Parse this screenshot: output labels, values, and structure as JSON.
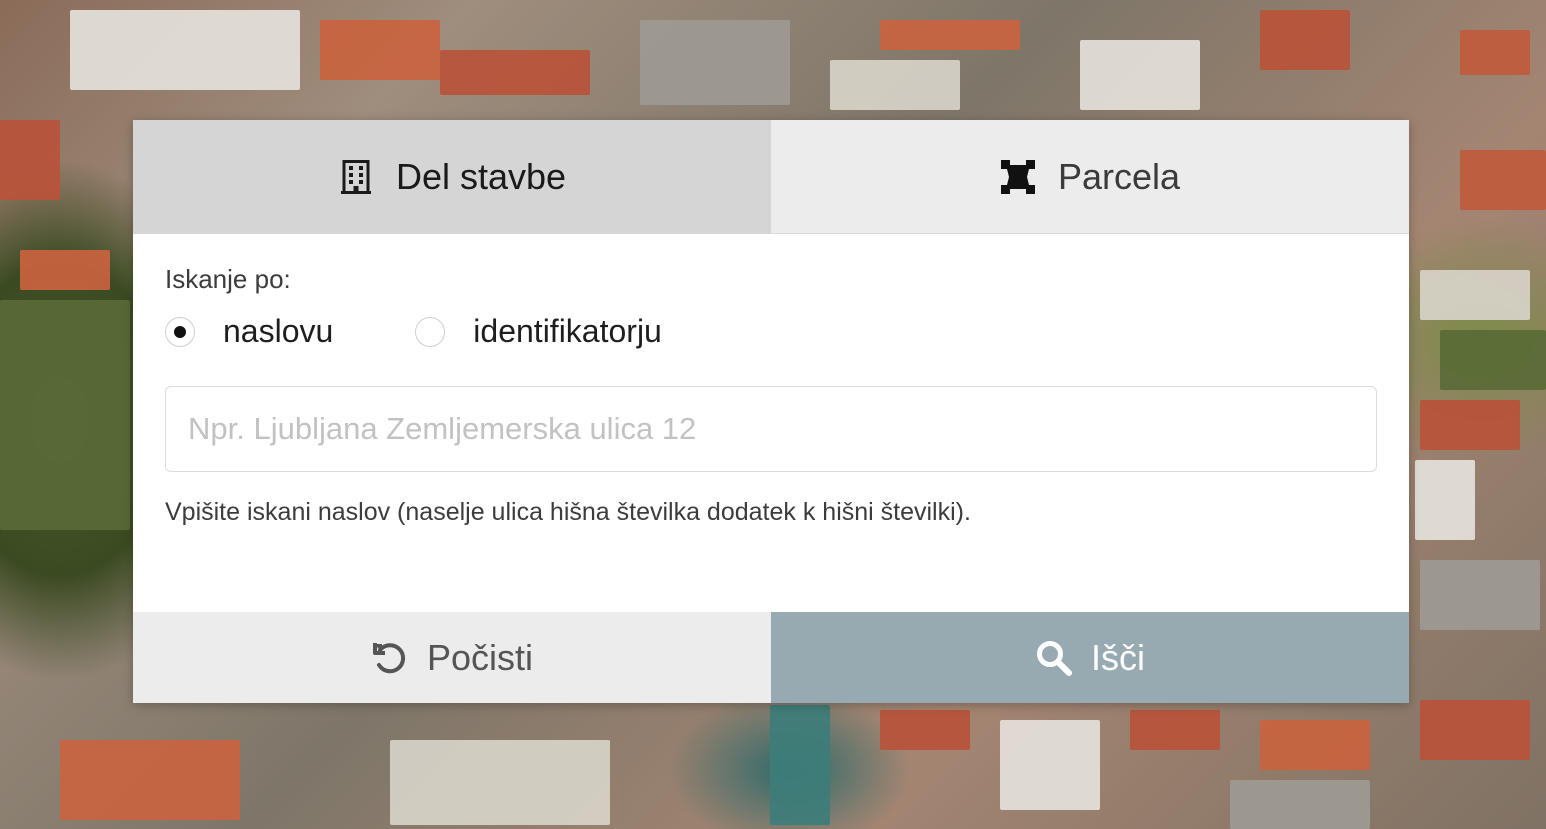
{
  "tabs": [
    {
      "label": "Del stavbe",
      "icon": "building-icon",
      "active": true
    },
    {
      "label": "Parcela",
      "icon": "parcel-polygon-icon",
      "active": false
    }
  ],
  "form": {
    "search_by_label": "Iskanje po:",
    "radio_options": [
      {
        "label": "naslovu",
        "checked": true
      },
      {
        "label": "identifikatorju",
        "checked": false
      }
    ],
    "input_value": "",
    "input_placeholder": "Npr. Ljubljana Zemljemerska ulica 12",
    "hint": "Vpišite iskani naslov (naselje ulica hišna številka dodatek k hišni številki)."
  },
  "buttons": {
    "clear_label": "Počisti",
    "clear_icon": "undo-icon",
    "search_label": "Išči",
    "search_icon": "search-icon"
  },
  "colors": {
    "active_tab": "#d5d5d5",
    "inactive_tab": "#ececec",
    "search_button": "#97aab2",
    "clear_button": "#ececec"
  }
}
